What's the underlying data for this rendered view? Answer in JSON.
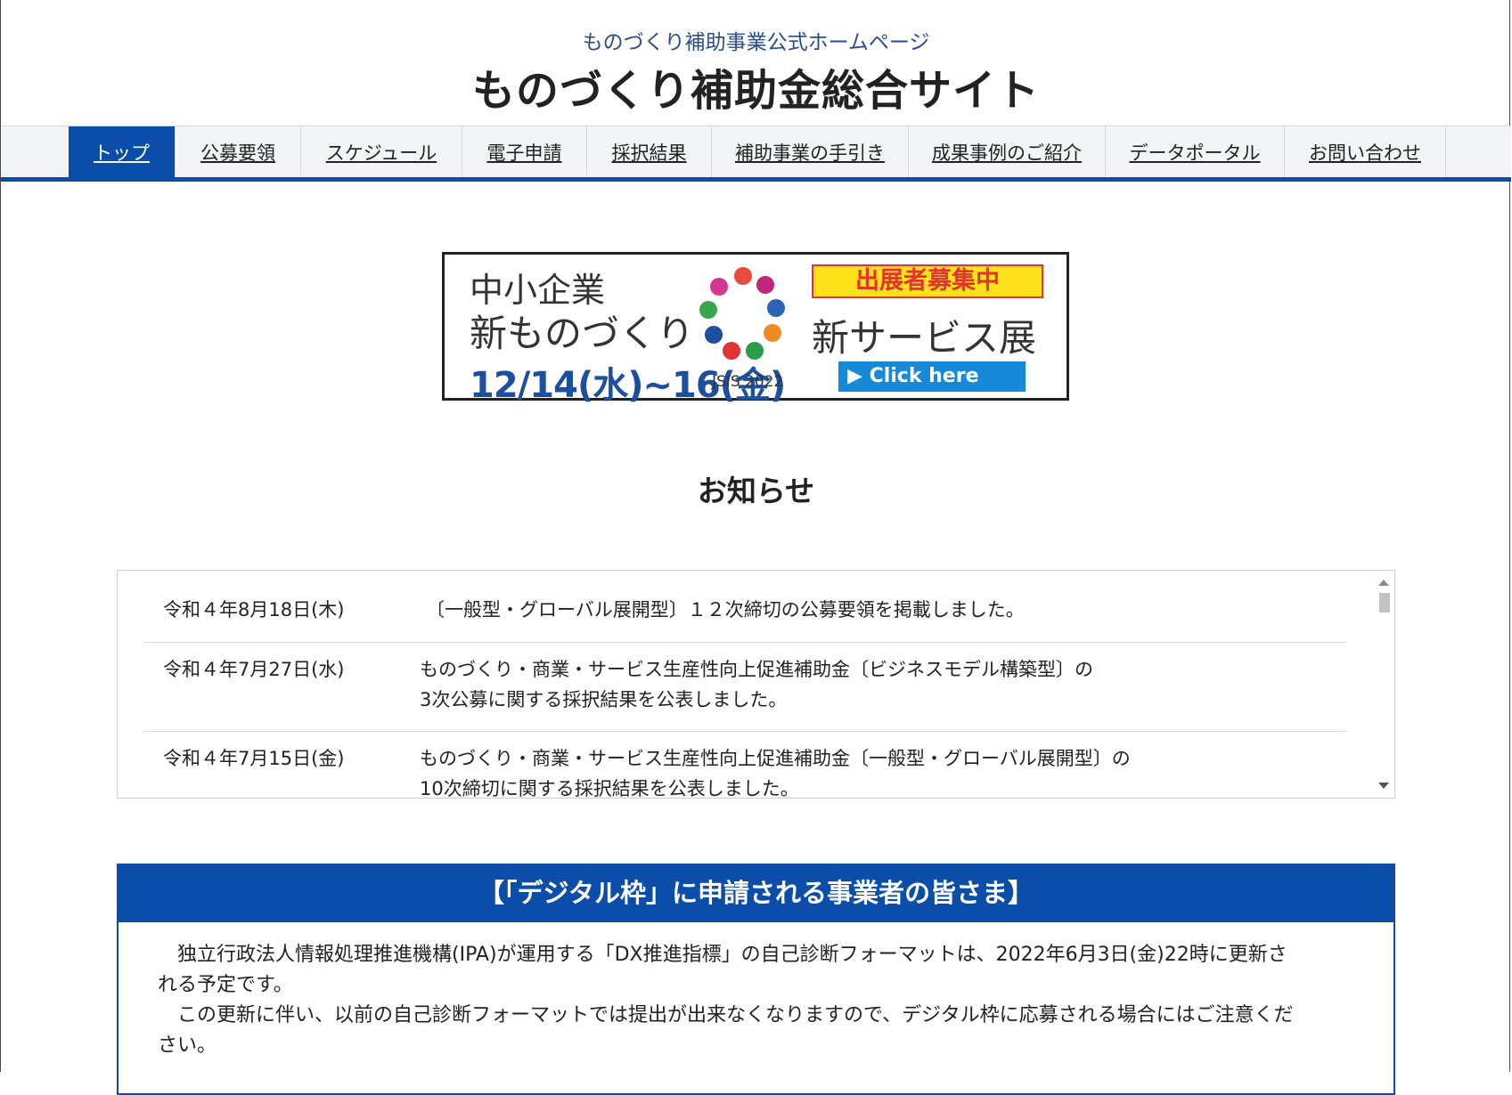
{
  "header": {
    "subtitle": "ものづくり補助事業公式ホームページ",
    "title": "ものづくり補助金総合サイト"
  },
  "nav": {
    "items": [
      {
        "label": "トップ"
      },
      {
        "label": "公募要領"
      },
      {
        "label": "スケジュール"
      },
      {
        "label": "電子申請"
      },
      {
        "label": "採択結果"
      },
      {
        "label": "補助事業の手引き"
      },
      {
        "label": "成果事例のご紹介"
      },
      {
        "label": "データポータル"
      },
      {
        "label": "お問い合わせ"
      }
    ]
  },
  "banner": {
    "line1": "中小企業",
    "line2": "新ものづくり",
    "date": "12/14(水)~16(金)",
    "recruit": "出展者募集中",
    "expo": "新サービス展",
    "click": "▶ Click here",
    "logo": "JSIS 2022"
  },
  "notice": {
    "title": "お知らせ",
    "items": [
      {
        "date": "令和４年8月18日(木)",
        "text1": "〔一般型・グローバル展開型〕１２次締切の公募要領を掲載しました。",
        "text2": ""
      },
      {
        "date": "令和４年7月27日(水)",
        "text1": "ものづくり・商業・サービス生産性向上促進補助金〔ビジネスモデル構築型〕の",
        "text2": "3次公募に関する採択結果を公表しました。"
      },
      {
        "date": "令和４年7月15日(金)",
        "text1": "ものづくり・商業・サービス生産性向上促進補助金〔一般型・グローバル展開型〕の",
        "text2": "10次締切に関する採択結果を公表しました。"
      }
    ]
  },
  "digital": {
    "heading": "【「デジタル枠」に申請される事業者の皆さま】",
    "p1a": "　独立行政法人情報処理推進機構(IPA)が運用する「DX推進指標」の自己診断フォーマットは、2022年6月3日(金)22時に更新さ",
    "p1b": "れる予定です。",
    "p2a": "　この更新に伴い、以前の自己診断フォーマットでは提出が出来なくなりますので、デジタル枠に応募される場合にはご注意くだ",
    "p2b": "さい。"
  }
}
